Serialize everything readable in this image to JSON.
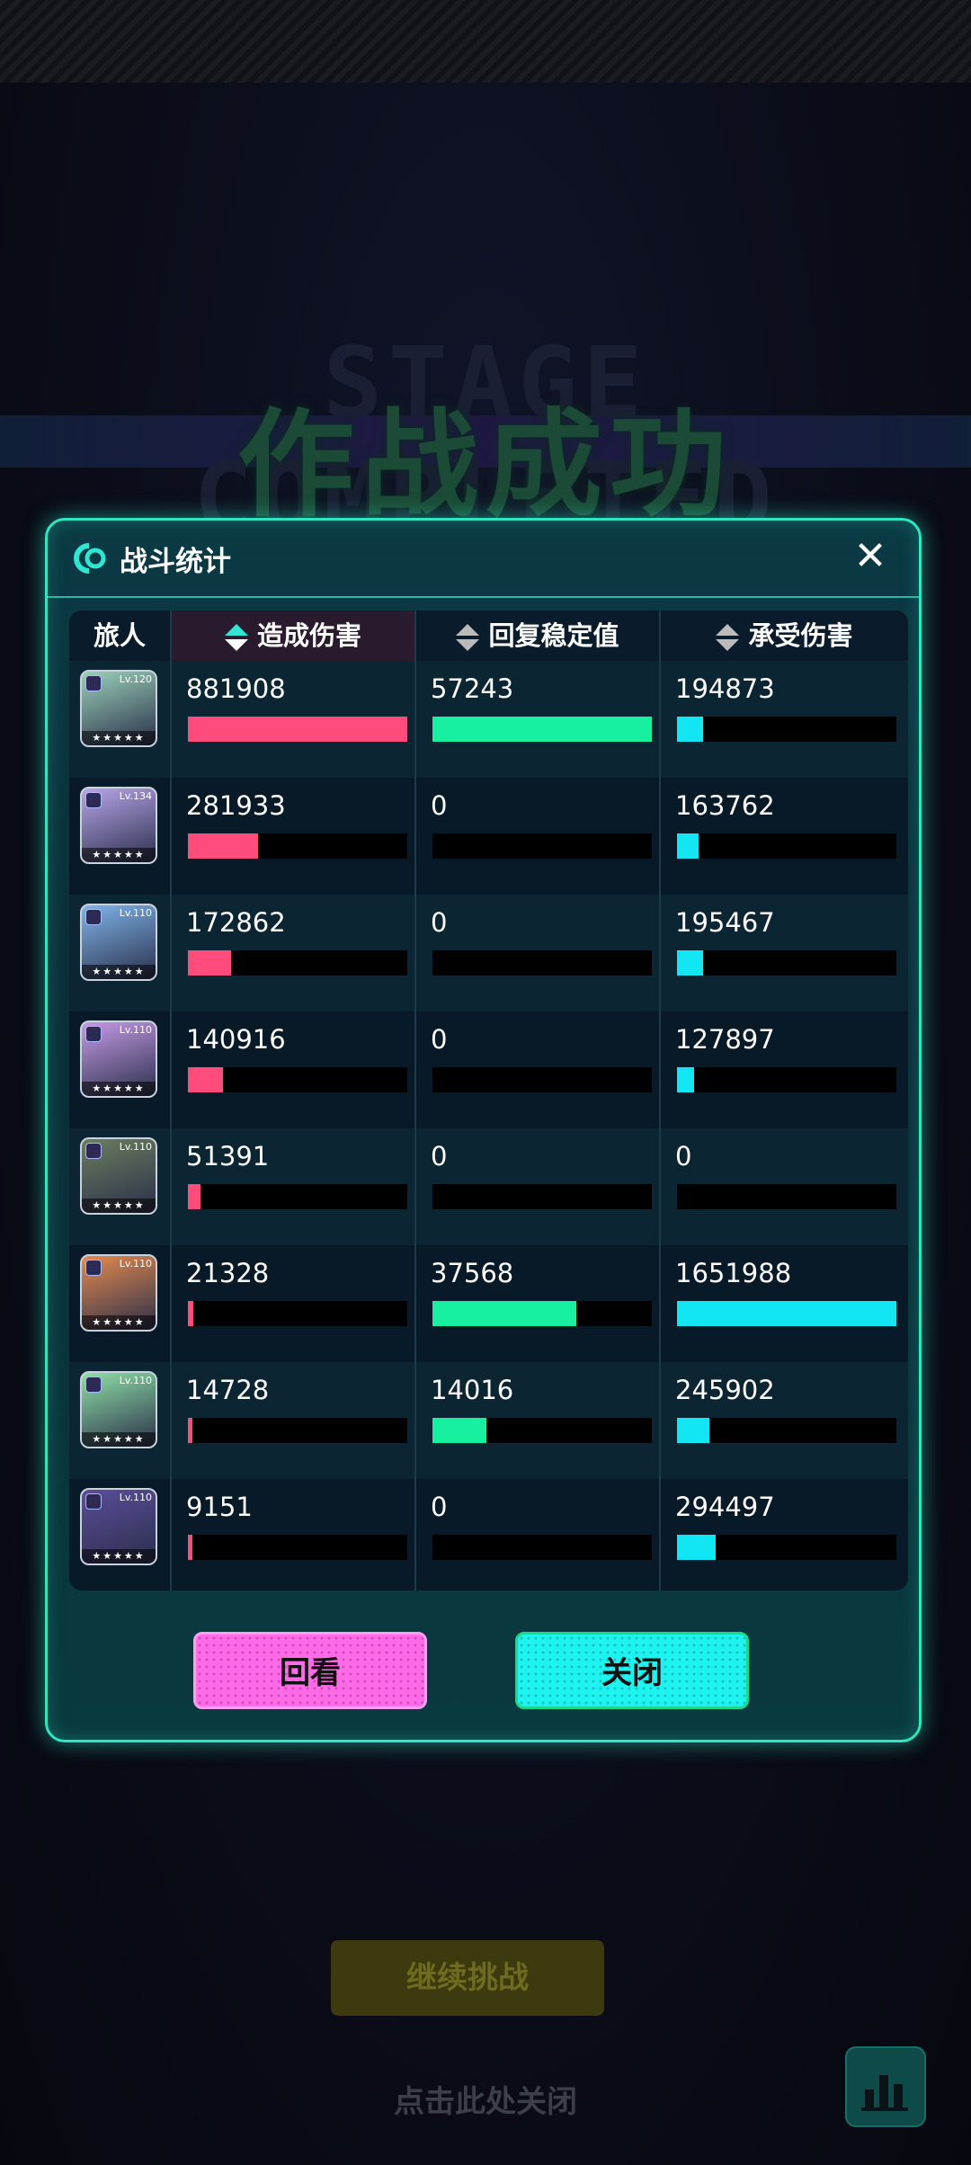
{
  "background": {
    "title": "作战成功",
    "english": "STAGE COMPLETED",
    "continue_button": "继续挑战",
    "tap_to_close": "点击此处关闭"
  },
  "panel": {
    "title": "战斗统计",
    "close_label": "✕",
    "headers": {
      "travelers": "旅人",
      "damage_dealt": "造成伤害",
      "recovery": "回复稳定值",
      "damage_taken": "承受伤害"
    },
    "max": {
      "damage_dealt": 881908,
      "recovery": 57243,
      "damage_taken": 1651988
    },
    "rows": [
      {
        "lv": "Lv.120",
        "damage_dealt": "881908",
        "recovery": "57243",
        "damage_taken": "194873"
      },
      {
        "lv": "Lv.134",
        "damage_dealt": "281933",
        "recovery": "0",
        "damage_taken": "163762"
      },
      {
        "lv": "Lv.110",
        "damage_dealt": "172862",
        "recovery": "0",
        "damage_taken": "195467"
      },
      {
        "lv": "Lv.110",
        "damage_dealt": "140916",
        "recovery": "0",
        "damage_taken": "127897"
      },
      {
        "lv": "Lv.110",
        "damage_dealt": "51391",
        "recovery": "0",
        "damage_taken": "0"
      },
      {
        "lv": "Lv.110",
        "damage_dealt": "21328",
        "recovery": "37568",
        "damage_taken": "1651988"
      },
      {
        "lv": "Lv.110",
        "damage_dealt": "14728",
        "recovery": "14016",
        "damage_taken": "245902"
      },
      {
        "lv": "Lv.110",
        "damage_dealt": "9151",
        "recovery": "0",
        "damage_taken": "294497"
      }
    ],
    "buttons": {
      "replay": "回看",
      "close": "关闭"
    }
  },
  "colors": {
    "damage_dealt": "#ff4c7c",
    "recovery": "#17f0a0",
    "damage_taken": "#12e6f2"
  },
  "avatar_colors": [
    "#9ad1b8",
    "#b9a6ea",
    "#7fb4ea",
    "#c59be6",
    "#6b7e5e",
    "#e58a4e",
    "#8ee0a6",
    "#5b4d9a"
  ]
}
